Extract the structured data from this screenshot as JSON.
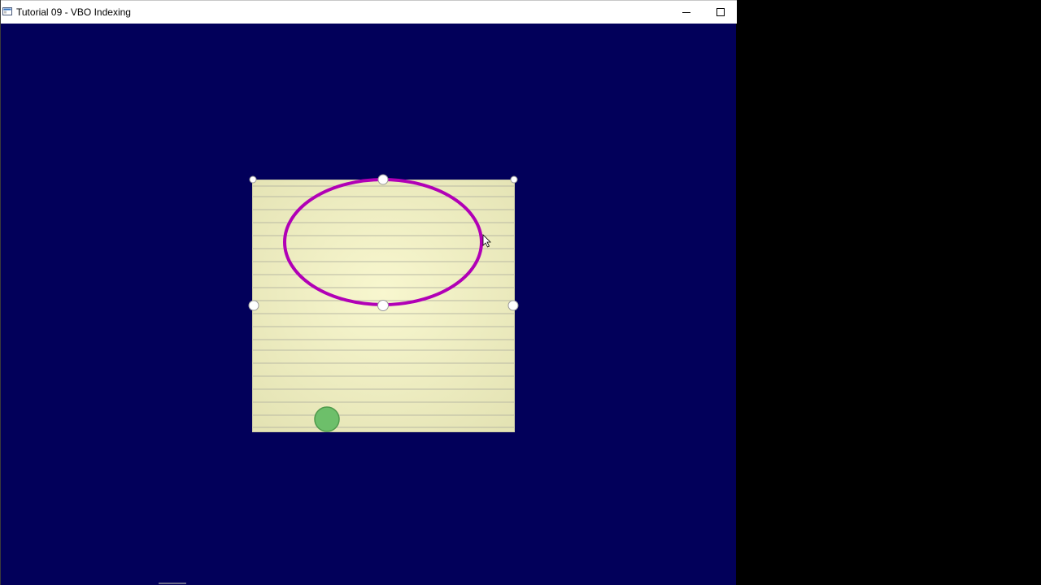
{
  "window": {
    "title": "Tutorial 09 - VBO Indexing",
    "minimize_icon": "minimize-icon",
    "maximize_icon": "maximize-icon",
    "app_icon": "opengl-app-icon"
  },
  "scene": {
    "background_color": "#02005a",
    "paper_color": "#f3f2c4",
    "line_color": "#b9b9a4",
    "ellipse_color": "#b100b6",
    "handle_color": "#ffffff",
    "dot_color": "#6dbf6a",
    "cursor": "arrow-cursor-icon"
  }
}
